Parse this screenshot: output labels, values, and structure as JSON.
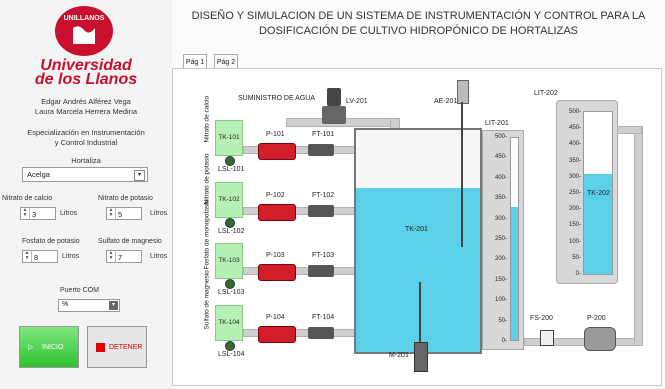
{
  "header": {
    "title_line1": "DISEÑO Y SIMULACION DE UN SISTEMA DE INSTRUMENTACIÓN Y CONTROL PARA LA",
    "title_line2": "DOSIFICACIÓN DE CULTIVO HIDROPÓNICO DE HORTALIZAS"
  },
  "sidebar": {
    "logo_arc": "UNILLANOS",
    "logo_line1": "Universidad",
    "logo_line2": "de los Llanos",
    "author1": "Edgar Andrés Alférez Vega",
    "author2": "Laura Marcela Herrera Medina",
    "program1": "Especialización en Instrumentación",
    "program2": "y Control Industrial",
    "hortaliza_label": "Hortaliza",
    "hortaliza_value": "Acelga",
    "calcio_label": "Nitrato de calcio",
    "calcio_value": "3",
    "potasio_label": "Nitrato de potasio",
    "potasio_value": "5",
    "fosfato_label": "Fosfato de potasio",
    "fosfato_value": "8",
    "sulfato_label": "Sulfato de magnesio",
    "sulfato_value": "7",
    "unit": "Litros",
    "com_label": "Puerto COM",
    "com_value": "%",
    "start_label": "INICIO",
    "stop_label": "DETENER"
  },
  "tabs": [
    {
      "label": "Pág 1"
    },
    {
      "label": "Pág 2"
    }
  ],
  "diagram": {
    "supply": "SUMINISTRO DE AGUA",
    "lv": "LV-201",
    "ae": "AE-201",
    "lit201": "LIT-201",
    "lit202": "LIT-202",
    "tk201": "TK-201",
    "tk202": "TK-202",
    "m201": "M-201",
    "fs200": "FS-200",
    "p200": "P-200",
    "tanks": [
      {
        "side": "Nitrato de calcio",
        "tk": "TK-101",
        "lsl": "LSL-101",
        "pump": "P-101",
        "ft": "FT-101"
      },
      {
        "side": "Nitrato de potasio",
        "tk": "TK-102",
        "lsl": "LSL-102",
        "pump": "P-102",
        "ft": "FT-102"
      },
      {
        "side": "Fosfato de monopotasio",
        "tk": "TK-103",
        "lsl": "LSL-103",
        "pump": "P-103",
        "ft": "FT-103"
      },
      {
        "side": "Sulfato de magnesio",
        "tk": "TK-104",
        "lsl": "LSL-104",
        "pump": "P-104",
        "ft": "FT-104"
      }
    ],
    "lit201_level": 0.66,
    "lit202_level": 0.62,
    "tk201_level": 0.74,
    "scale201": [
      "500-",
      "450-",
      "400-",
      "350-",
      "300-",
      "250-",
      "200-",
      "150-",
      "100-",
      "50-",
      "0-"
    ],
    "scale202": [
      "500-",
      "450-",
      "400-",
      "350-",
      "300-",
      "250-",
      "200-",
      "150-",
      "100-",
      "50-",
      "0-"
    ]
  },
  "colors": {
    "brand": "#c8102e",
    "water": "#5bd0e8",
    "tank_green": "#b5f1b5",
    "pump_red": "#d11e2a"
  }
}
